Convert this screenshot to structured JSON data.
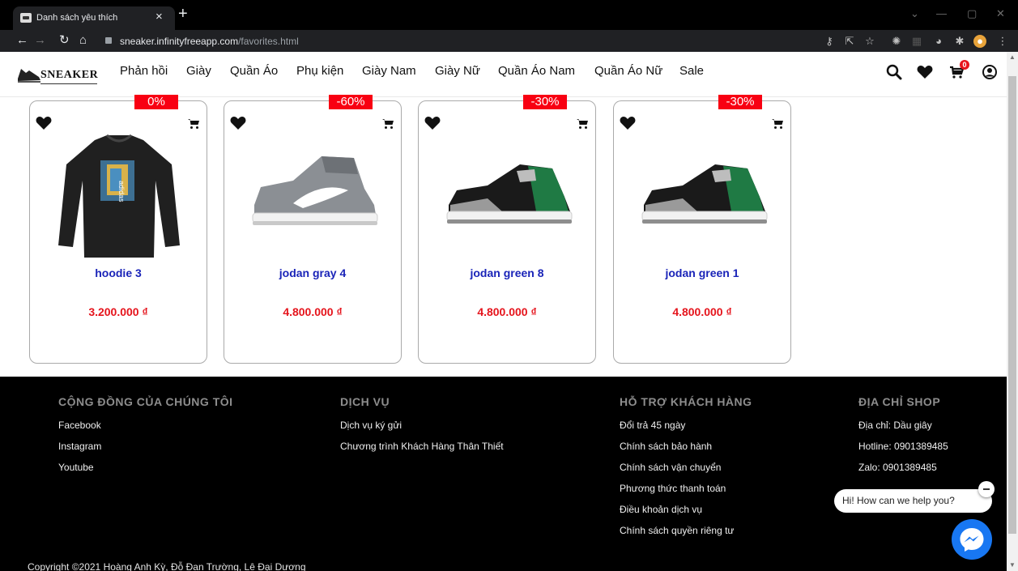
{
  "browser": {
    "tab_title": "Danh sách yêu thích",
    "tab_close": "×",
    "new_tab": "+",
    "url_host": "sneaker.infinityfreeapp.com",
    "url_path": "/favorites.html",
    "win_minimize": "—",
    "win_restore": "▢",
    "win_close": "✕",
    "win_dropdown": "⌄"
  },
  "site": {
    "logo_text": "SNEAKER",
    "nav": [
      "Phản hồi",
      "Giày",
      "Quần Áo",
      "Phụ kiện",
      "Giày Nam",
      "Giày Nữ",
      "Quần Áo Nam",
      "Quần Áo Nữ",
      "Sale"
    ],
    "cart_count": "0"
  },
  "products": [
    {
      "name": "hoodie 3",
      "price": "3.200.000 ₫",
      "discount": "0%",
      "image": "hoodie"
    },
    {
      "name": "jodan gray 4",
      "price": "4.800.000 ₫",
      "discount": "-60%",
      "image": "gray-sneaker"
    },
    {
      "name": "jodan green 8",
      "price": "4.800.000 ₫",
      "discount": "-30%",
      "image": "green-sneaker"
    },
    {
      "name": "jodan green 1",
      "price": "4.800.000 ₫",
      "discount": "-30%",
      "image": "green-sneaker"
    }
  ],
  "footer": {
    "columns": [
      {
        "heading": "CỘNG ĐỒNG CỦA CHÚNG TÔI",
        "items": [
          "Facebook",
          "Instagram",
          "Youtube"
        ]
      },
      {
        "heading": "DỊCH VỤ",
        "items": [
          "Dịch vụ ký gửi",
          "Chương trình Khách Hàng Thân Thiết"
        ]
      },
      {
        "heading": "HỖ TRỢ KHÁCH HÀNG",
        "items": [
          "Đổi trả 45 ngày",
          "Chính sách bảo hành",
          "Chính sách vận chuyển",
          "Phương thức thanh toán",
          "Điều khoản dịch vụ",
          "Chính sách quyền riêng tư"
        ]
      },
      {
        "heading": "ĐỊA CHỈ SHOP",
        "items": [
          "Địa chỉ: Dầu giây",
          "Hotline: 0901389485",
          "Zalo: 0901389485"
        ]
      }
    ],
    "copyright": "Copyright ©2021 Hoàng Anh Kỳ, Đỗ Đan Trường, Lê Đại Dương"
  },
  "chat": {
    "greeting": "Hi! How can we help you?"
  },
  "colors": {
    "discount_bg": "#f80012",
    "product_name": "#1a24b8",
    "price": "#e5141c",
    "messenger": "#1877f2"
  }
}
